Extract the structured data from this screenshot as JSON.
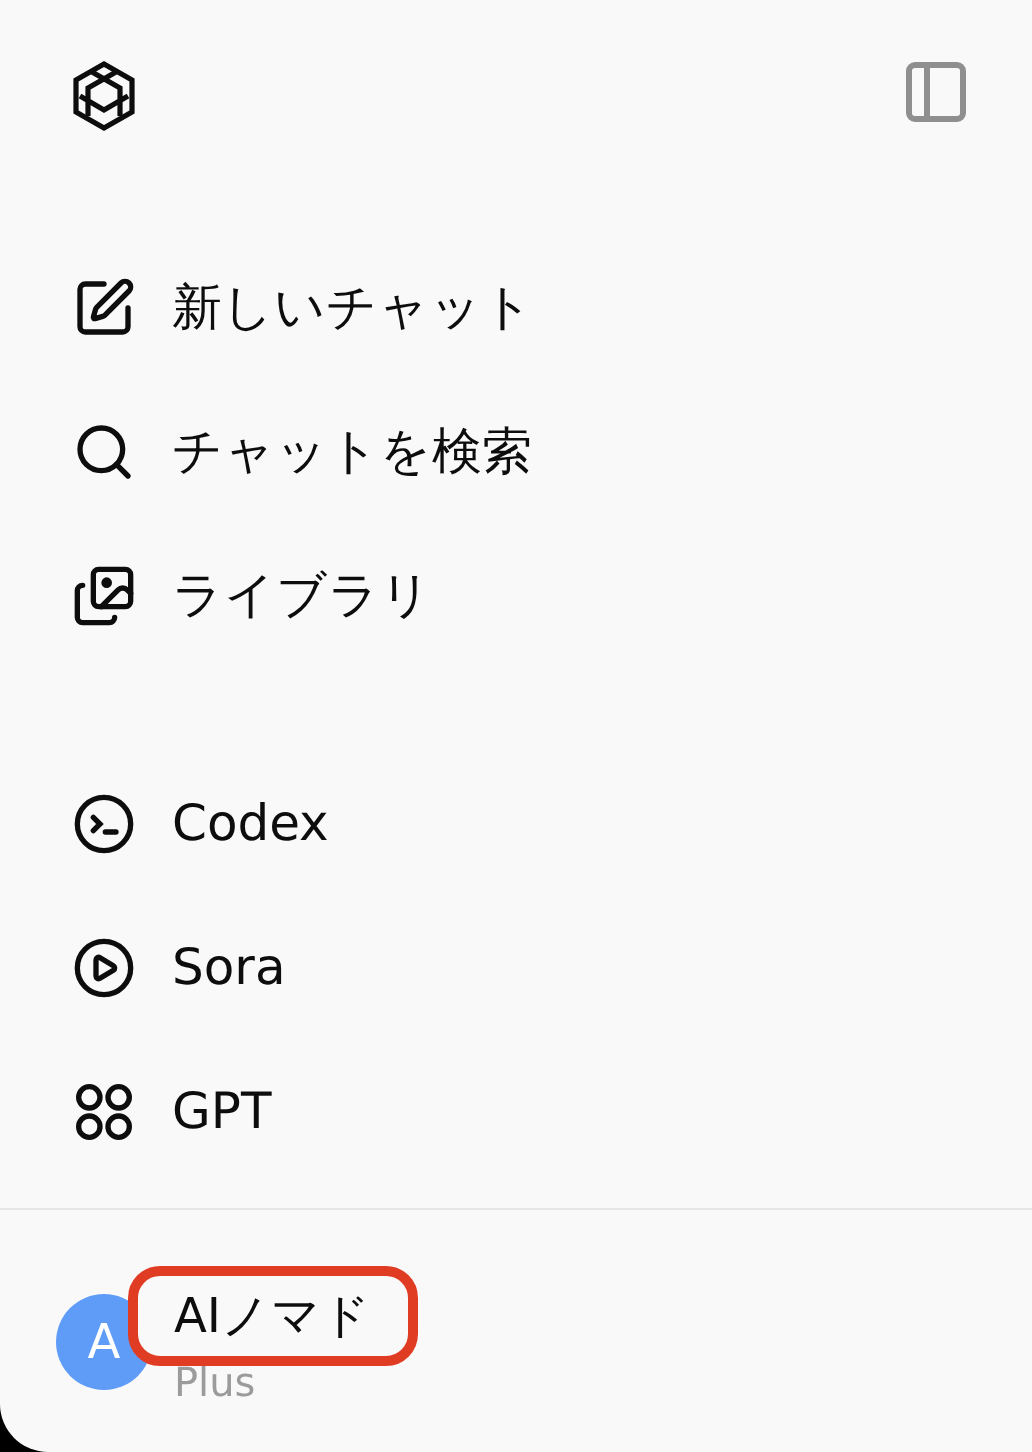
{
  "primary_items": [
    {
      "kind": "new-chat",
      "label": "新しいチャット"
    },
    {
      "kind": "search",
      "label": "チャットを検索"
    },
    {
      "kind": "library",
      "label": "ライブラリ"
    }
  ],
  "app_items": [
    {
      "kind": "codex",
      "label": "Codex"
    },
    {
      "kind": "sora",
      "label": "Sora"
    },
    {
      "kind": "gpts",
      "label": "GPT"
    }
  ],
  "account": {
    "avatar_letter": "A",
    "name": "AIノマド",
    "plan": "Plus",
    "highlighted": true
  }
}
